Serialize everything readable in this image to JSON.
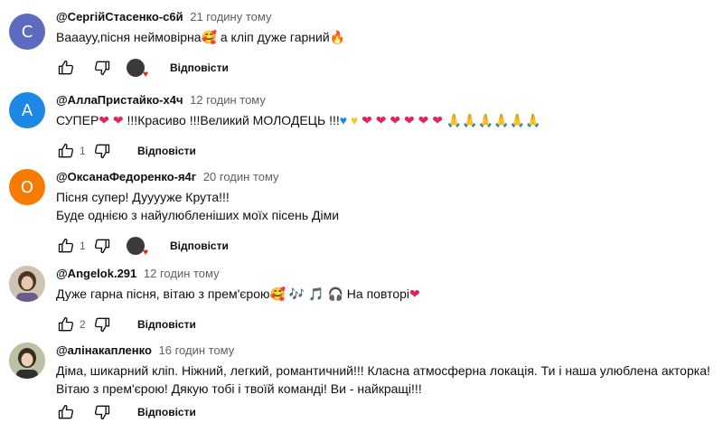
{
  "reply_label": "Відповісти",
  "colors": {
    "c1": "#5c6bc0",
    "c2": "#1e88e5",
    "c3": "#f57c00"
  },
  "comments": [
    {
      "author": "@СергійСтасенко-с6й",
      "time": "21 годину тому",
      "avatar_letter": "С",
      "text_a": "Вааауу,пісня неймовірна",
      "text_b": " а кліп дуже гарний",
      "likes": ""
    },
    {
      "author": "@АллаПристайко-х4ч",
      "time": "12 годин тому",
      "avatar_letter": "А",
      "text_a": "СУПЕР",
      "text_b": "!!!Красиво !!!Великий МОЛОДЕЦЬ !!!",
      "likes": "1"
    },
    {
      "author": "@ОксанаФедоренко-я4г",
      "time": "20 годин тому",
      "avatar_letter": "О",
      "text": "Пісня супер! Дууууже Крута!!!\nБуде однією з найулюбленіших моїх пісень Діми",
      "likes": "1"
    },
    {
      "author": "@Angelok.291",
      "time": "12 годин тому",
      "text_a": "Дуже гарна пісня, вітаю з прем'єрою",
      "text_b": " На повторі",
      "likes": "2"
    },
    {
      "author": "@алінакапленко",
      "time": "16 годин тому",
      "text": "Діма, шикарний кліп. Ніжний, легкий, романтичний!!! Класна атмосферна локація. Ти і наша улюблена акторка! Вітаю з прем'єрою! Дякую тобі і твоїй команді! Ви - найкращі!!!",
      "likes": ""
    }
  ]
}
